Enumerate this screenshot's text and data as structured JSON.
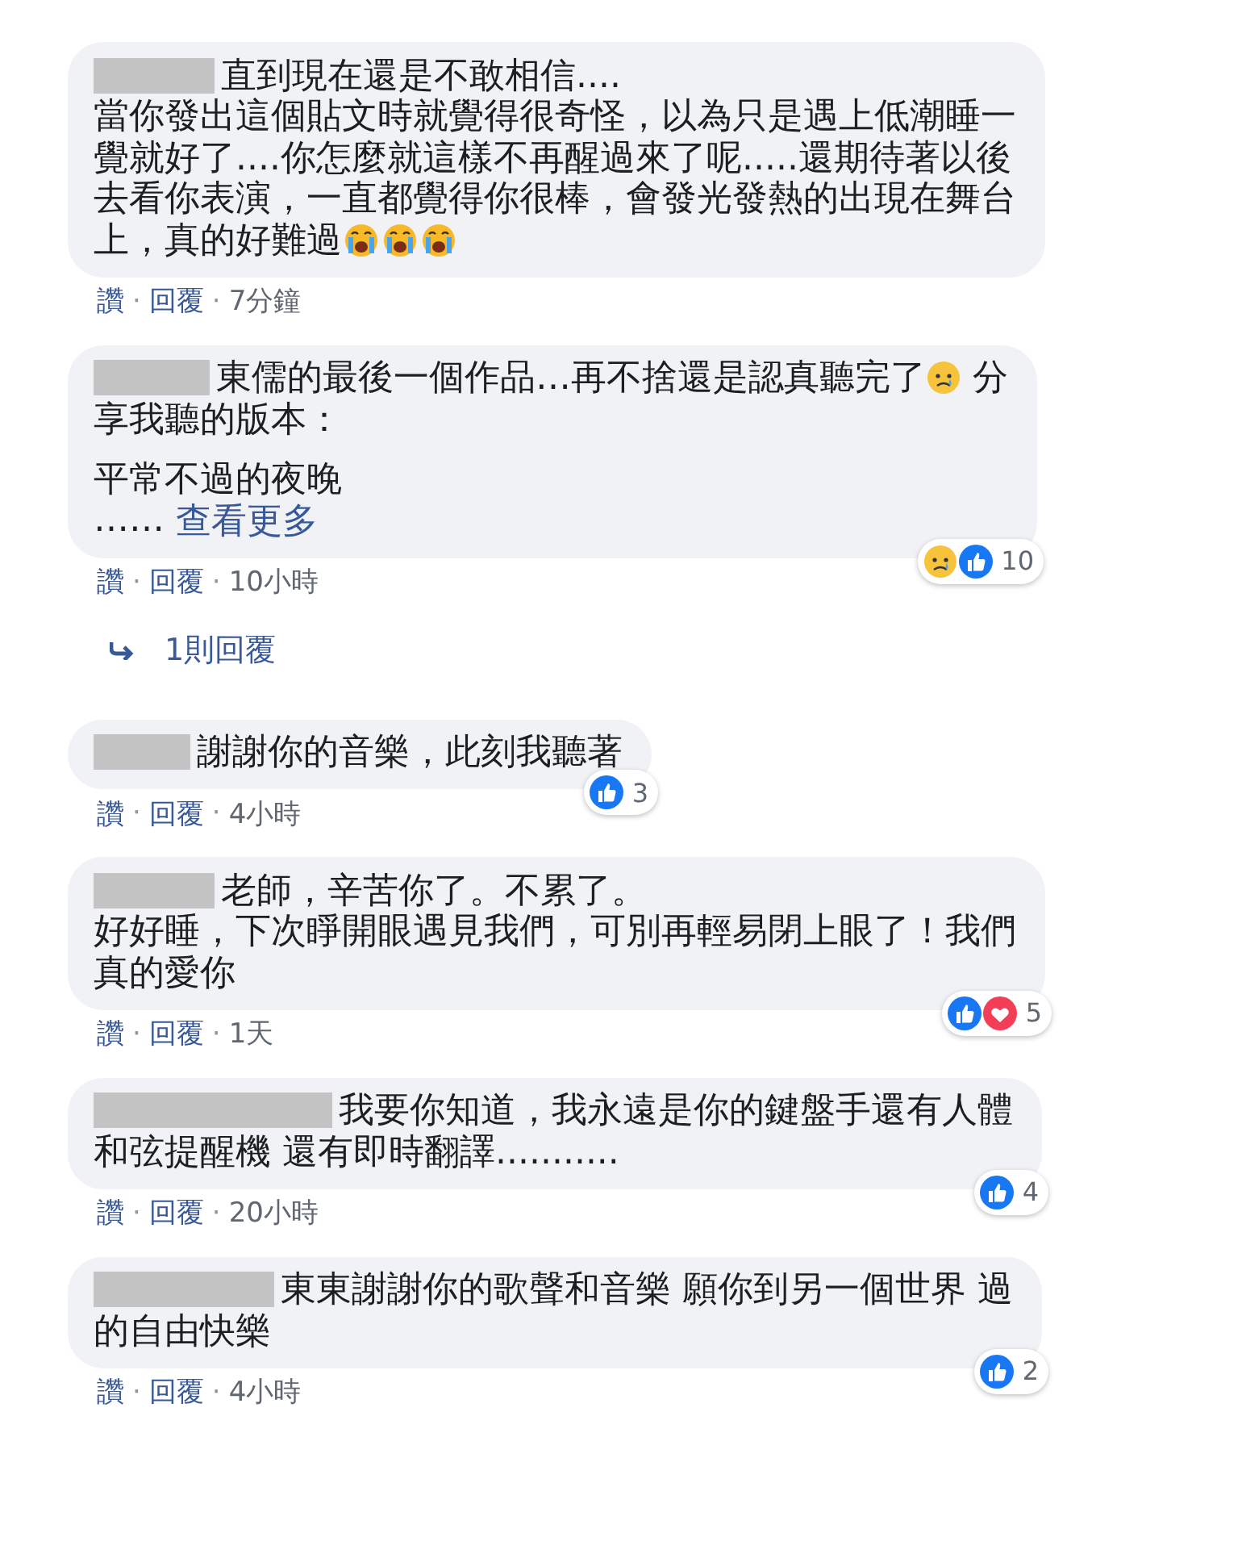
{
  "comments": [
    {
      "paragraphs": [
        [
          [
            {
              "kind": "text",
              "text": "直到現在還是不敢相信...."
            }
          ],
          [
            {
              "kind": "text",
              "text": "當你發出這個貼文時就覺得很奇怪，以為只是遇上低潮睡一"
            }
          ],
          [
            {
              "kind": "text",
              "text": "覺就好了....你怎麼就這樣不再醒過來了呢.....還期待著以後"
            }
          ],
          [
            {
              "kind": "text",
              "text": "去看你表演，一直都覺得你很棒，會發光發熱的出現在舞台"
            }
          ],
          [
            {
              "kind": "text",
              "text": "上，真的好難過"
            },
            {
              "kind": "crying"
            },
            {
              "kind": "crying"
            },
            {
              "kind": "crying"
            }
          ]
        ]
      ],
      "actions": [
        "讚",
        "·",
        "回覆",
        "·"
      ],
      "time": "7分鐘"
    },
    {
      "paragraphs": [
        [
          [
            {
              "kind": "text",
              "text": "東儒的最後一個作品…再不捨還是認真聽完了"
            },
            {
              "kind": "sad"
            },
            {
              "kind": "text",
              "text": " 分"
            }
          ],
          [
            {
              "kind": "text",
              "text": "享我聽的版本："
            }
          ]
        ],
        [
          [
            {
              "kind": "text",
              "text": "平常不過的夜晚"
            }
          ],
          [
            {
              "kind": "text",
              "text": "…… "
            },
            {
              "kind": "link",
              "text": "查看更多"
            }
          ]
        ]
      ],
      "actions": [
        "讚",
        "·",
        "回覆",
        "·"
      ],
      "time": "10小時",
      "reactions": {
        "icons": [
          {
            "kind": "sad"
          },
          {
            "kind": "like"
          }
        ],
        "count": "10"
      },
      "replies": "1則回覆"
    },
    {
      "paragraphs": [
        [
          [
            {
              "kind": "text",
              "text": "謝謝你的音樂，此刻我聽著"
            }
          ]
        ]
      ],
      "actions": [
        "讚",
        "·",
        "回覆",
        "·"
      ],
      "time": "4小時",
      "reactions": {
        "icons": [
          {
            "kind": "like"
          }
        ],
        "count": "3"
      }
    },
    {
      "paragraphs": [
        [
          [
            {
              "kind": "text",
              "text": "老師，辛苦你了。不累了。"
            }
          ],
          [
            {
              "kind": "text",
              "text": "好好睡，下次睜開眼遇見我們，可別再輕易閉上眼了！我們"
            }
          ],
          [
            {
              "kind": "text",
              "text": "真的愛你"
            }
          ]
        ]
      ],
      "actions": [
        "讚",
        "·",
        "回覆",
        "·"
      ],
      "time": "1天",
      "reactions": {
        "icons": [
          {
            "kind": "like"
          },
          {
            "kind": "love"
          }
        ],
        "count": "5"
      }
    },
    {
      "paragraphs": [
        [
          [
            {
              "kind": "text",
              "text": "我要你知道，我永遠是你的鍵盤手還有人體"
            }
          ],
          [
            {
              "kind": "text",
              "text": "和弦提醒機 還有即時翻譯..........."
            }
          ]
        ]
      ],
      "actions": [
        "讚",
        "·",
        "回覆",
        "·"
      ],
      "time": "20小時",
      "reactions": {
        "icons": [
          {
            "kind": "like"
          }
        ],
        "count": "4"
      }
    },
    {
      "paragraphs": [
        [
          [
            {
              "kind": "text",
              "text": "東東謝謝你的歌聲和音樂 願你到另一個世界 過"
            }
          ],
          [
            {
              "kind": "text",
              "text": "的自由快樂"
            }
          ]
        ]
      ],
      "actions": [
        "讚",
        "·",
        "回覆",
        "·"
      ],
      "time": "4小時",
      "reactions": {
        "icons": [
          {
            "kind": "like"
          }
        ],
        "count": "2"
      }
    }
  ]
}
